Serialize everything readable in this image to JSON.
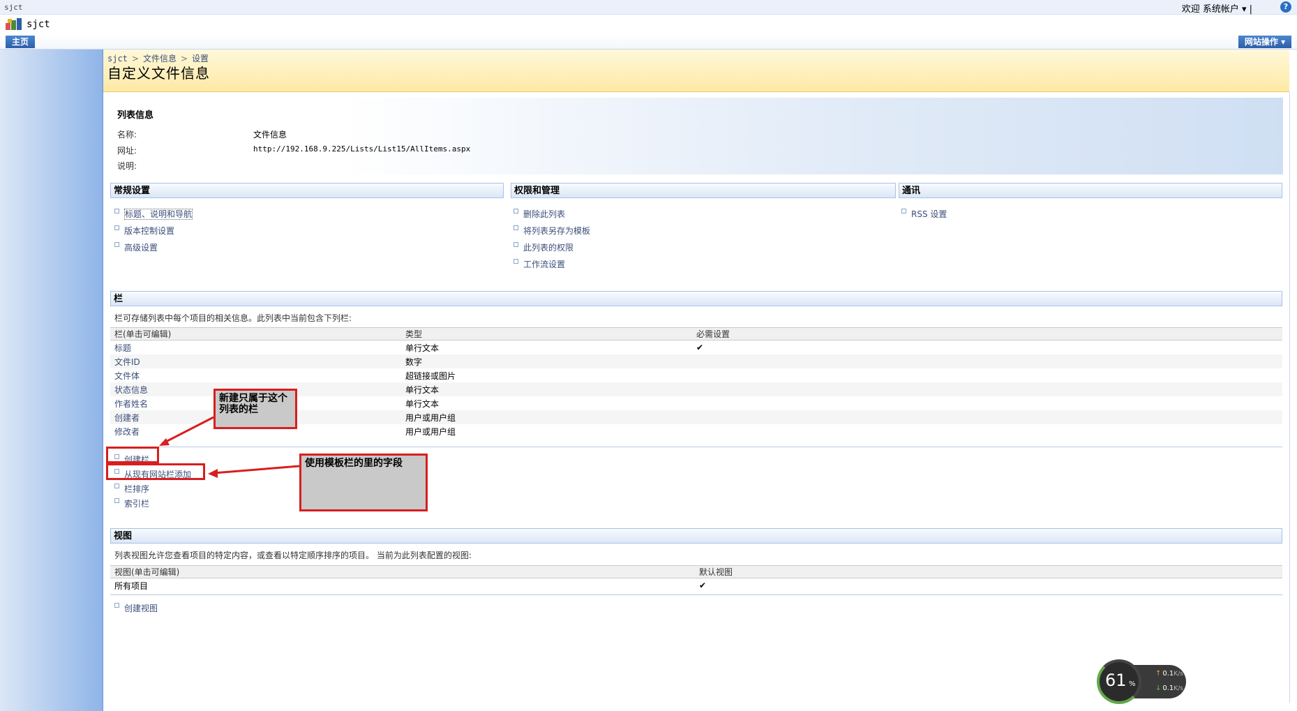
{
  "top": {
    "site_name": "sjct",
    "welcome": "欢迎 系统帐户 ▾ |",
    "help": "?"
  },
  "header": {
    "site_title": "sjct"
  },
  "nav": {
    "home_tab": "主页",
    "site_actions": "网站操作 ▾"
  },
  "breadcrumb": {
    "root": "sjct",
    "sep": ">",
    "list": "文件信息",
    "current": "设置"
  },
  "page_title": "自定义文件信息",
  "list_info": {
    "heading": "列表信息",
    "name_label": "名称:",
    "name_value": "文件信息",
    "url_label": "网址:",
    "url_value": "http://192.168.9.225/Lists/List15/AllItems.aspx",
    "desc_label": "说明:"
  },
  "sections": {
    "general": {
      "title": "常规设置",
      "links": [
        "标题、说明和导航",
        "版本控制设置",
        "高级设置"
      ]
    },
    "permissions": {
      "title": "权限和管理",
      "links": [
        "删除此列表",
        "将列表另存为模板",
        "此列表的权限",
        "工作流设置"
      ]
    },
    "communications": {
      "title": "通讯",
      "links": [
        "RSS 设置"
      ]
    }
  },
  "columns": {
    "title": "栏",
    "description": "栏可存储列表中每个项目的相关信息。此列表中当前包含下列栏:",
    "headers": [
      "栏(单击可编辑)",
      "类型",
      "必需设置"
    ],
    "rows": [
      [
        "标题",
        "单行文本",
        "✔"
      ],
      [
        "文件ID",
        "数字",
        ""
      ],
      [
        "文件体",
        "超链接或图片",
        ""
      ],
      [
        "状态信息",
        "单行文本",
        ""
      ],
      [
        "作者姓名",
        "单行文本",
        ""
      ],
      [
        "创建者",
        "用户或用户组",
        ""
      ],
      [
        "修改者",
        "用户或用户组",
        ""
      ]
    ],
    "links": [
      "创建栏",
      "从现有网站栏添加",
      "栏排序",
      "索引栏"
    ]
  },
  "views": {
    "title": "视图",
    "description": "列表视图允许您查看项目的特定内容，或查看以特定顺序排序的项目。 当前为此列表配置的视图:",
    "headers": [
      "视图(单击可编辑)",
      "默认视图"
    ],
    "rows": [
      [
        "所有项目",
        "✔"
      ]
    ],
    "links": [
      "创建视图"
    ]
  },
  "annotations": {
    "callout_1": "新建只属于这个列表的栏",
    "callout_2": "使用模板栏的里的字段",
    "color": "#d81e1e"
  },
  "speed_widget": {
    "percent": "61",
    "percent_sign": "%",
    "up": "0.1",
    "down": "0.1",
    "unit": "K/s"
  },
  "colors": {
    "accent": "#2d5ea8",
    "title_bg": "#fde9a5",
    "link": "#3b4f7a"
  }
}
